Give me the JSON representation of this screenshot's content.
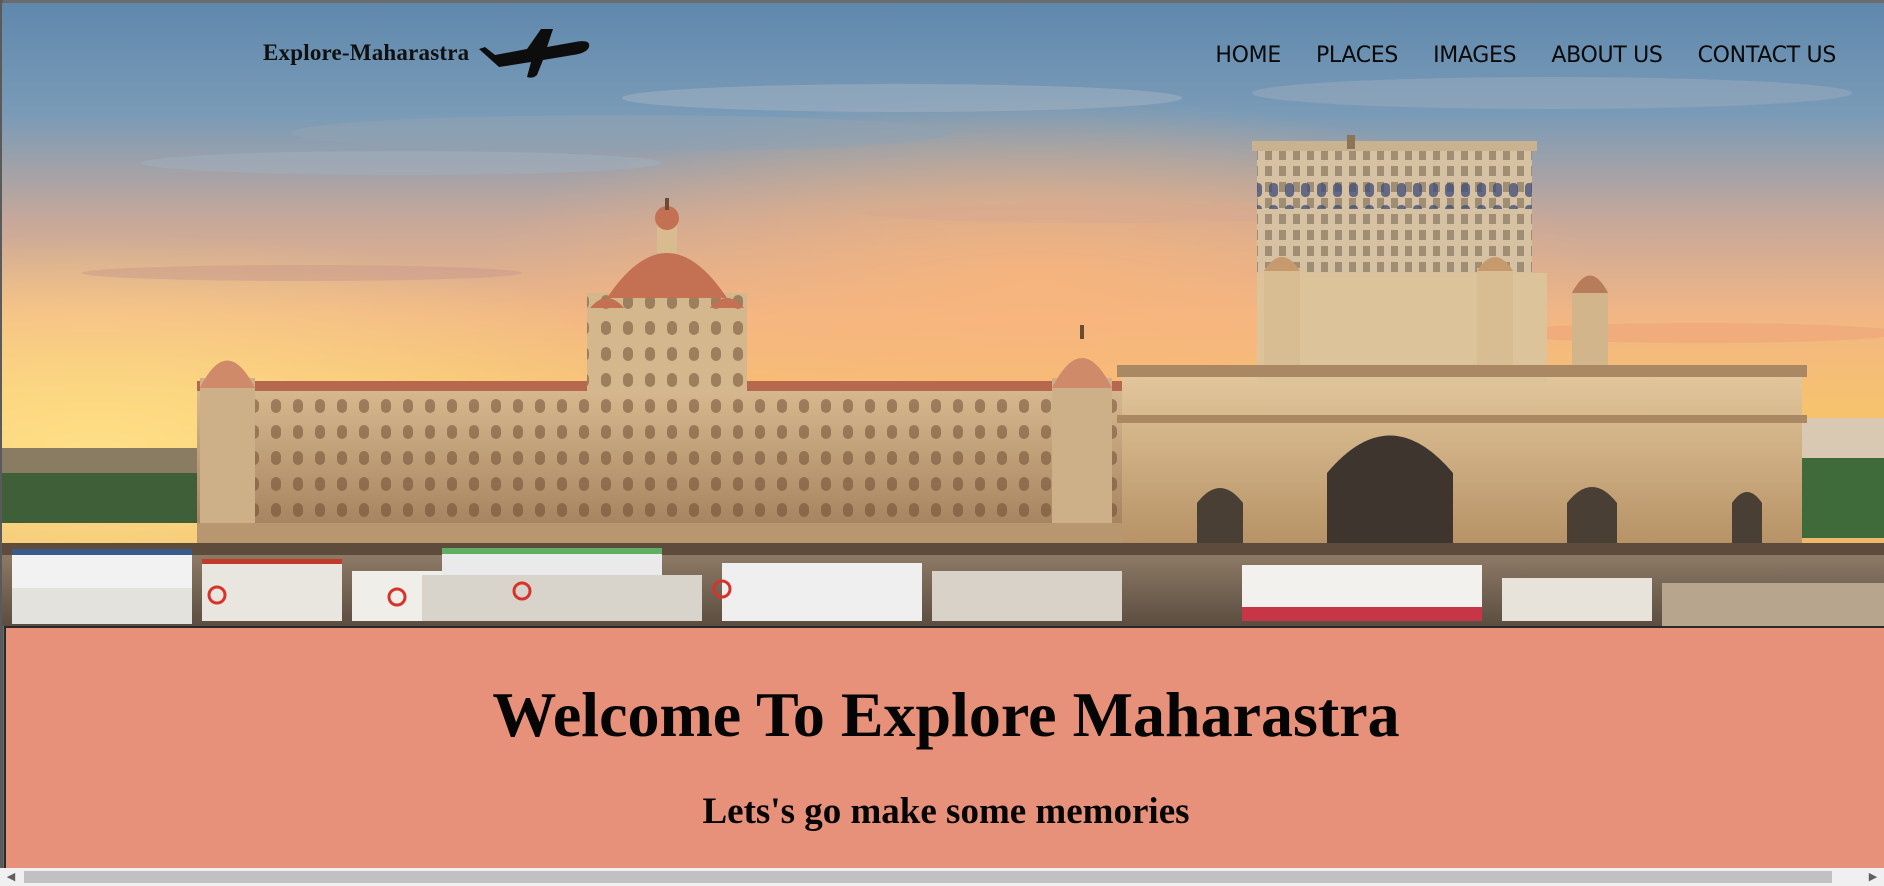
{
  "brand": {
    "name": "Explore-Maharastra",
    "icon": "airplane-icon"
  },
  "nav": {
    "items": [
      {
        "label": "HOME"
      },
      {
        "label": "PLACES"
      },
      {
        "label": "IMAGES"
      },
      {
        "label": "ABOUT US"
      },
      {
        "label": "CONTACT US"
      }
    ]
  },
  "hero": {
    "image": "gateway-of-india-taj-hotel-photo"
  },
  "welcome": {
    "title": "Welcome To Explore Maharastra",
    "subtitle": "Lets's go make some memories",
    "background": "#e8917a"
  },
  "scrollbar": {
    "left_icon": "scroll-left-arrow-icon",
    "right_icon": "scroll-right-arrow-icon"
  }
}
